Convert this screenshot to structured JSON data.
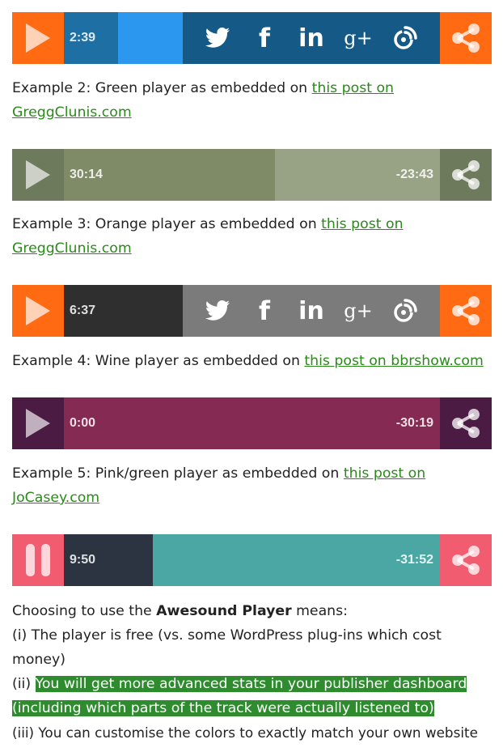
{
  "colors": {
    "orange": "#ff6a13",
    "blue_dark": "#155a86",
    "blue_mid": "#1e6fa3",
    "blue_fill": "#2b97ee",
    "green_btn": "#6e7a5c",
    "green_fill": "#7f8a67",
    "green_rest": "#98a386",
    "gray_dark": "#2f2f2f",
    "gray_social": "#7b7b7b",
    "wine_btn": "#4c1b43",
    "wine_fill": "#852a52",
    "pink": "#f25c70",
    "slate": "#2b3440",
    "teal": "#4ba7a3",
    "link": "#2a8a1a",
    "highlight": "#2e8b2e"
  },
  "icons": {
    "play": "play-icon",
    "pause": "pause-icon",
    "share": "share-icon",
    "twitter": "twitter-icon",
    "facebook": "facebook-icon",
    "linkedin": "linkedin-icon",
    "googleplus": "google-plus-icon",
    "rss": "podcast-feed-icon"
  },
  "players": [
    {
      "id": "blue",
      "time": "2:39",
      "progress_fraction": 0.18
    },
    {
      "id": "green",
      "time": "30:14",
      "remaining": "-23:43",
      "progress_fraction": 0.56
    },
    {
      "id": "orange",
      "time": "6:37",
      "progress_fraction": 0.2
    },
    {
      "id": "wine",
      "time": "0:00",
      "remaining": "-30:19",
      "progress_fraction": 0.0
    },
    {
      "id": "pink",
      "time": "9:50",
      "remaining": "-31:52",
      "progress_fraction": 0.24
    }
  ],
  "social_labels": {
    "facebook": "f",
    "linkedin": "in",
    "googleplus": "g+"
  },
  "texts": {
    "ex2_prefix": "Example 2: Green player as embedded on ",
    "ex2_link_line1": "this post on",
    "ex2_link_line2": "GreggClunis.com",
    "ex3_prefix": "Example 3: Orange player as embedded on ",
    "ex3_link_line1": "this post on",
    "ex3_link_line2": "GreggClunis.com",
    "ex4_prefix": "Example 4: Wine player as embedded on ",
    "ex4_link": "this post on bbrshow.com",
    "ex5_prefix": "Example 5: Pink/green player as embedded on ",
    "ex5_link_line1": "this post on",
    "ex5_link_line2": "JoCasey.com",
    "summary_prefix": "Choosing to use the ",
    "summary_bold": "Awesound Player",
    "summary_suffix": " means:",
    "point1_line1": "(i) The player is free (vs. some WordPress plug-ins which cost",
    "point1_line2": "money)",
    "point2_prefix": "(ii) ",
    "point2_hl_line1": "You will get more advanced stats in your publisher dashboard",
    "point2_hl_line2": "(including which parts of the track were actually listened to)",
    "point3": "(iii) You can customise the colors to exactly match your own website"
  }
}
